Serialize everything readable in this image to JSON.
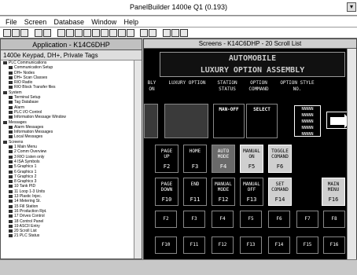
{
  "app": {
    "title": "PanelBuilder 1400e  Q1 (0.193)"
  },
  "menu": [
    "File",
    "Screen",
    "Database",
    "Window",
    "Help"
  ],
  "left_pane": {
    "title": "Application - K14C6DHP",
    "subtitle": "1400e Keypad, DH+, Private Tags",
    "tree": [
      "PLC Communications",
      "Communication Setup",
      "DH+ Nodes",
      "DH+ Scan Classes",
      "RIO Radio",
      "RIO Block Transfer files",
      "System",
      "Terminal Setup",
      "Tag Database",
      "Alarm",
      "PLC I/O Control",
      "Information Message Window",
      "Messages",
      "Alarm Messages",
      "Information Messages",
      "Local Messages",
      "Screens",
      "1 Main Menu",
      "2 Comm Overview",
      "3 RIO Listen only",
      "4 ISA Symbols",
      "5 Graphics 1",
      "6 Graphics 1",
      "7 Graphics 2",
      "8 Graphics 3",
      "10 Tank PID",
      "11 Loop 1-3 Units",
      "13 Plastic Injec.",
      "14 Metering St.",
      "15 Fill Station",
      "16 Production Rpt.",
      "17 Drives Control",
      "18 Control Panel",
      "19 ASCII Entry",
      "20 Scroll List",
      "21 PLC Status"
    ]
  },
  "screen": {
    "title": "Screens - K14C6DHP - 20 Scroll List",
    "banner_line1": "AUTOMOBILE",
    "banner_line2": "LUXURY OPTION ASSEMBLY",
    "headers": [
      "BLY\nON",
      "LUXURY\nOPTION",
      "STATION\nSTATUS",
      "OPTION\nCOMMAND",
      "OPTION\nSTYLE NO."
    ],
    "status_label": "MAN-OFF",
    "command_label": "SELECT",
    "style_values": [
      "NNNNN",
      "NNNNN",
      "NNNNN",
      "NNNNN",
      "NNNNN"
    ],
    "keys_row1": [
      {
        "text": "PAGE\nUP",
        "f": "F2"
      },
      {
        "text": "HOME",
        "f": "F3"
      },
      {
        "text": "AUTO\nMODE",
        "f": "F4"
      },
      {
        "text": "MANUAL\nON",
        "f": "F5"
      },
      {
        "text": "TOGGLE\nCOMAND",
        "f": "F6"
      }
    ],
    "keys_row2": [
      {
        "text": "PAGE\nDOWN",
        "f": "F10"
      },
      {
        "text": "END",
        "f": "F11"
      },
      {
        "text": "MANUAL\nMODE",
        "f": "F12"
      },
      {
        "text": "MANUAL\nOFF",
        "f": "F13"
      },
      {
        "text": "SET\nCOMAND",
        "f": "F14"
      },
      {
        "text": "MAIN\nMENU",
        "f": "F16"
      }
    ],
    "fkeys_row1": [
      "F2",
      "F3",
      "F4",
      "F5",
      "F6",
      "F7",
      "F8"
    ],
    "fkeys_row2": [
      "F10",
      "F11",
      "F12",
      "F13",
      "F14",
      "F15",
      "F16"
    ]
  }
}
